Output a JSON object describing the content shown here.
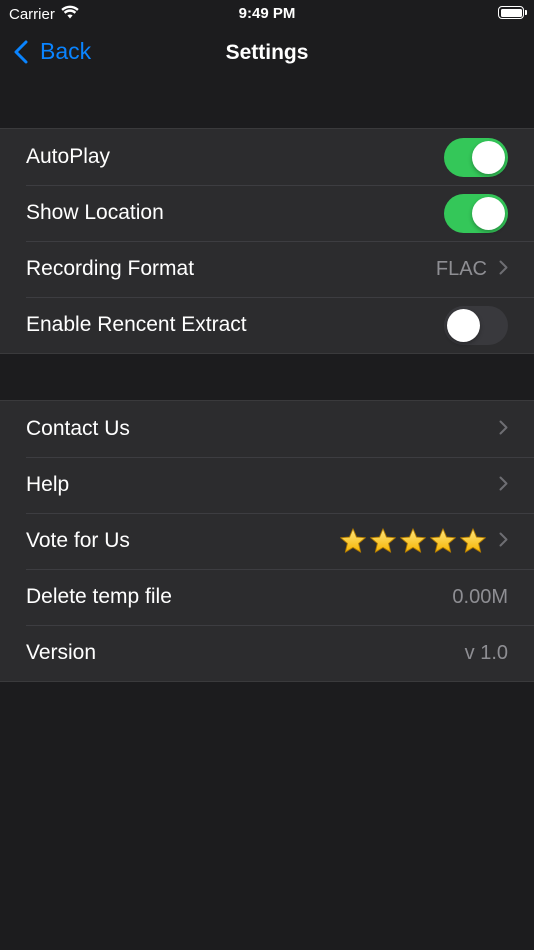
{
  "status_bar": {
    "carrier": "Carrier",
    "time": "9:49 PM"
  },
  "nav": {
    "back_label": "Back",
    "title": "Settings"
  },
  "group1": {
    "autoplay": {
      "label": "AutoPlay",
      "on": true
    },
    "show_location": {
      "label": "Show Location",
      "on": true
    },
    "recording_format": {
      "label": "Recording Format",
      "value": "FLAC"
    },
    "enable_recent_extract": {
      "label": "Enable Rencent Extract",
      "on": false
    }
  },
  "group2": {
    "contact_us": {
      "label": "Contact Us"
    },
    "help": {
      "label": "Help"
    },
    "vote": {
      "label": "Vote for Us",
      "rating": 5,
      "max_rating": 5
    },
    "delete_temp": {
      "label": "Delete temp file",
      "value": "0.00M"
    },
    "version": {
      "label": "Version",
      "value": "v 1.0"
    }
  },
  "colors": {
    "background": "#1c1c1e",
    "cell": "#2c2c2e",
    "accent": "#0a84ff",
    "toggle_on": "#34c759",
    "toggle_off": "#39393d",
    "secondary_text": "#8e8e93",
    "star": "#ffcc00"
  }
}
